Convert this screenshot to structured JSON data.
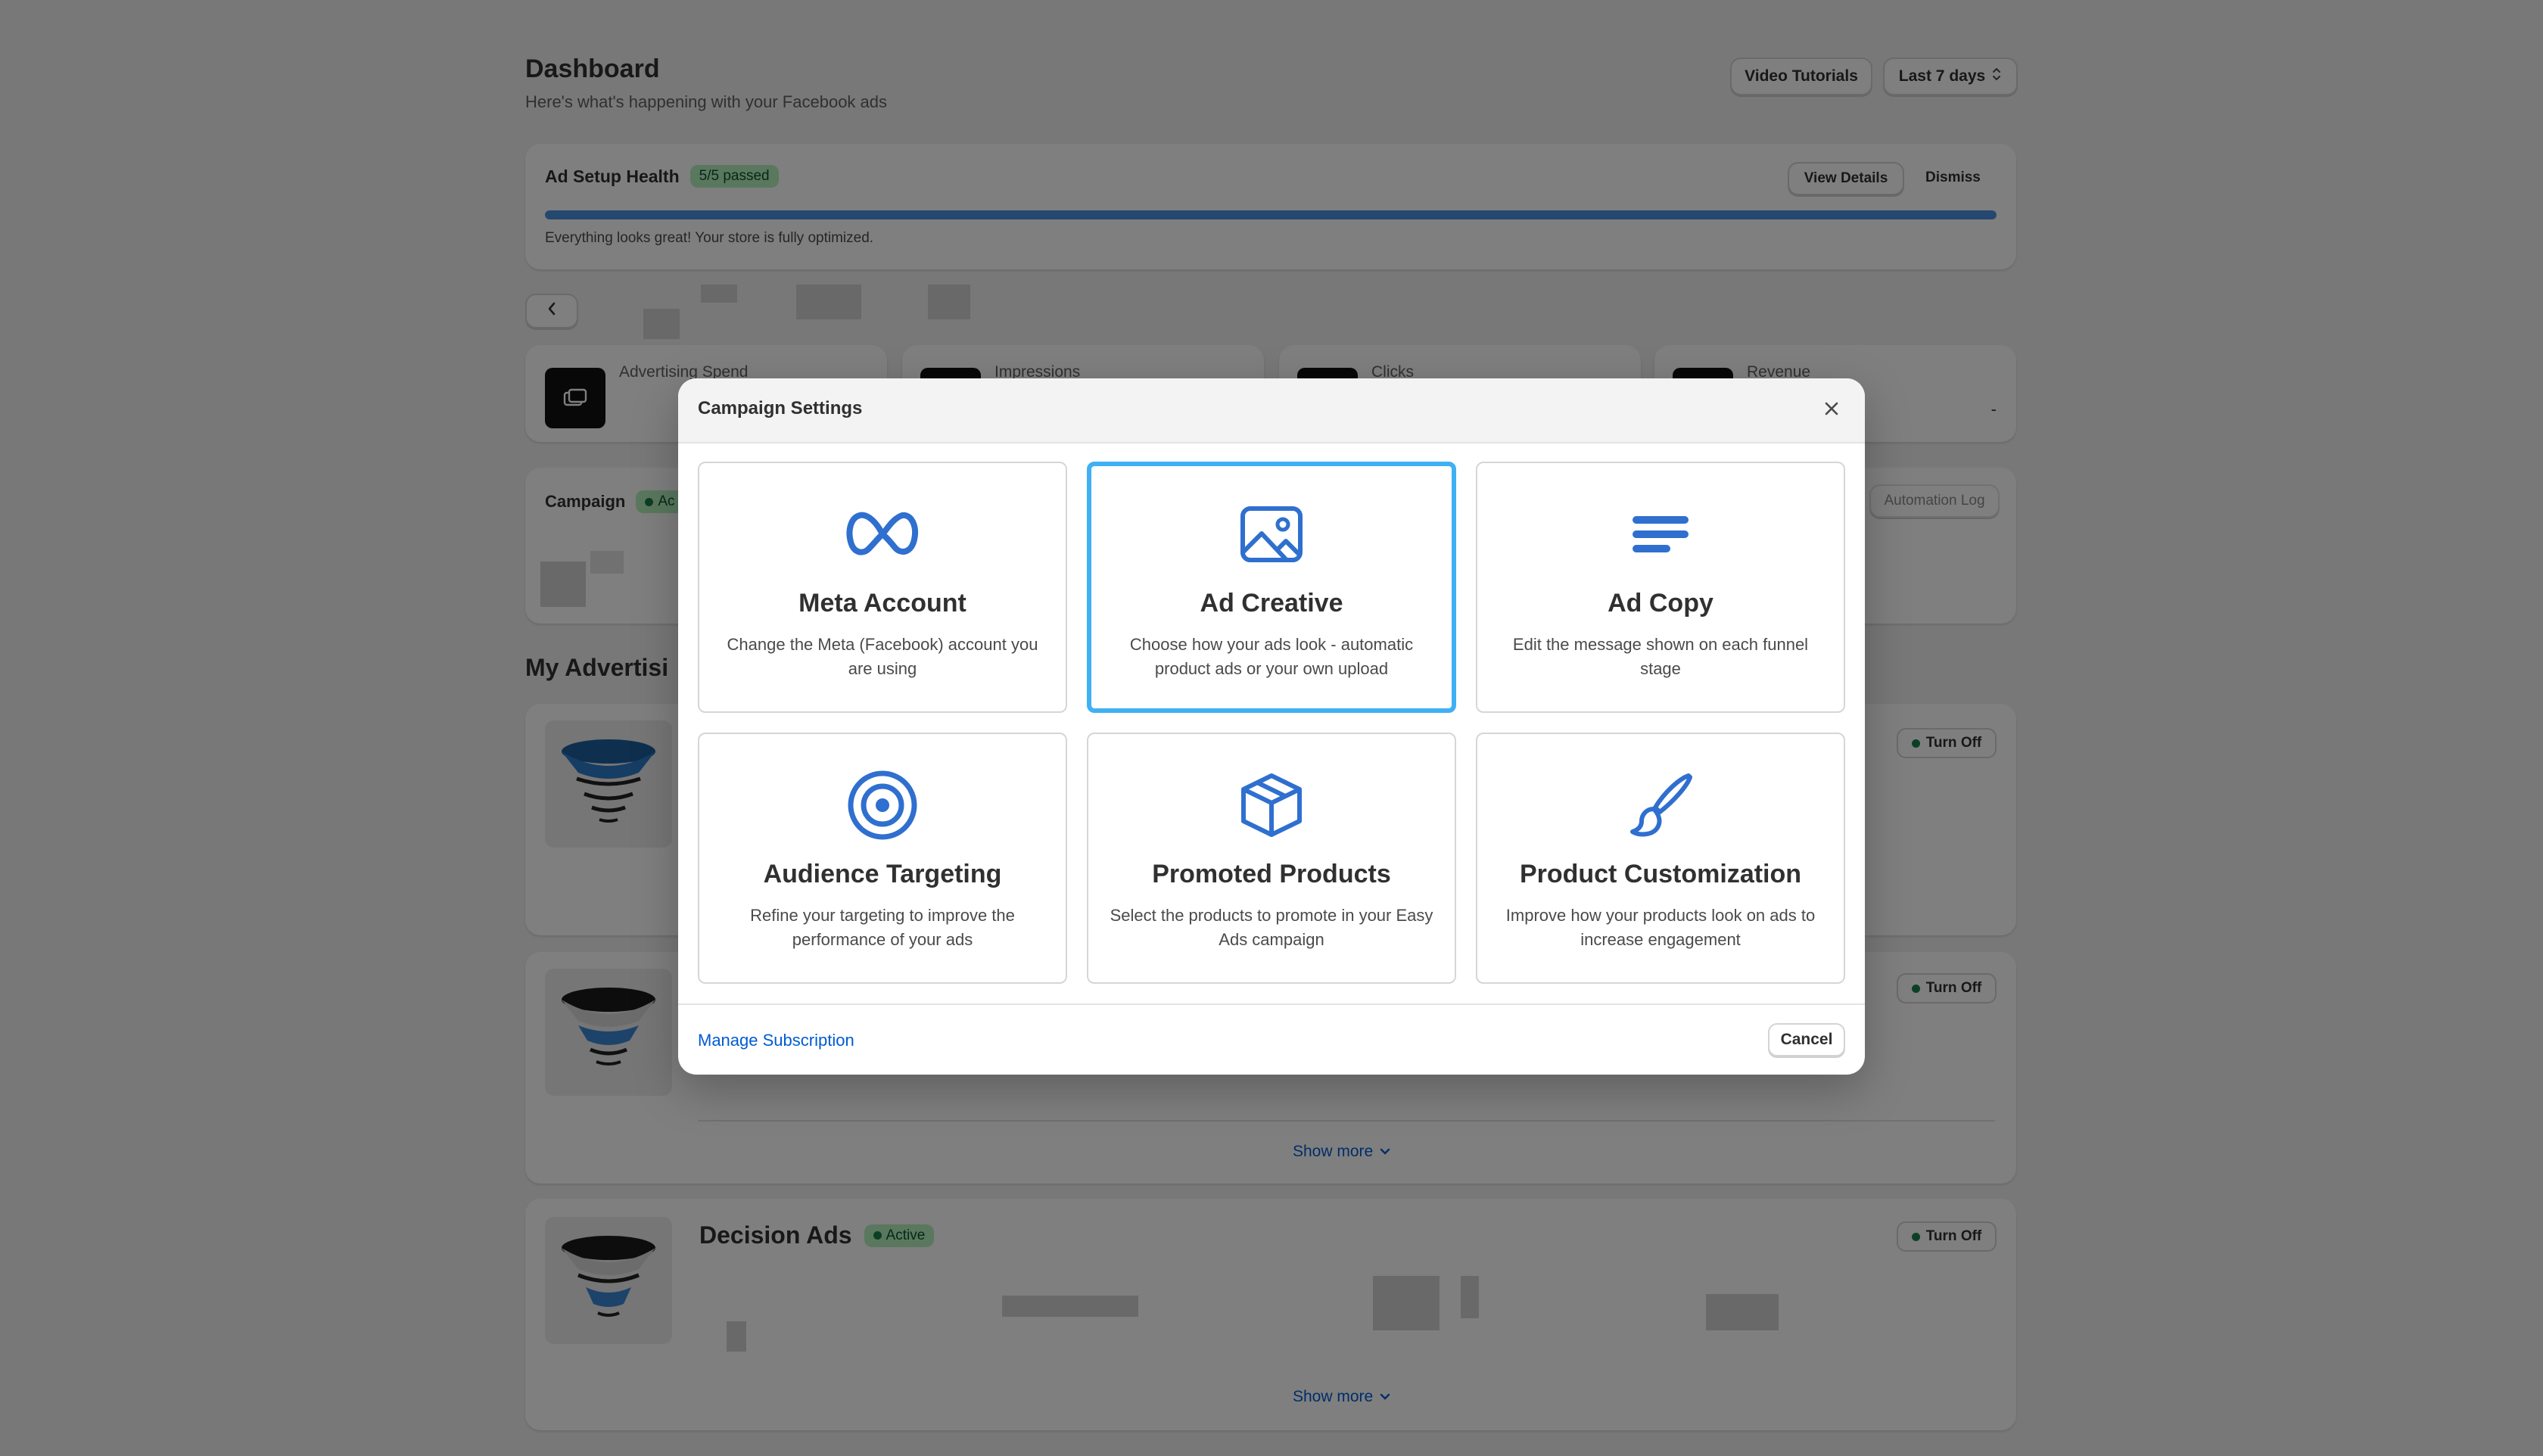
{
  "dashboard": {
    "title": "Dashboard",
    "subtitle": "Here's what's happening with your Facebook ads",
    "video_tutorials_label": "Video Tutorials",
    "date_range_label": "Last 7 days",
    "health": {
      "title": "Ad Setup Health",
      "badge": "5/5 passed",
      "progress_percent": 100,
      "message": "Everything looks great! Your store is fully optimized.",
      "view_details_label": "View Details",
      "dismiss_label": "Dismiss"
    },
    "metrics": [
      {
        "label": "Advertising Spend"
      },
      {
        "label": "Impressions"
      },
      {
        "label": "Clicks"
      },
      {
        "label": "Revenue",
        "value": "-"
      }
    ],
    "campaign": {
      "label": "Campaign",
      "badge": "Ac",
      "automation_log_label": "Automation Log"
    },
    "section_title": "My Advertisi",
    "ads": [
      {
        "turn_off_label": "Turn Off"
      },
      {
        "turn_off_label": "Turn Off",
        "show_more_label": "Show more"
      },
      {
        "title": "Decision Ads",
        "status": "Active",
        "turn_off_label": "Turn Off",
        "show_more_label": "Show more"
      }
    ]
  },
  "modal": {
    "title": "Campaign Settings",
    "options": [
      {
        "title": "Meta Account",
        "description": "Change the Meta (Facebook) account you are using",
        "icon": "meta-logo-icon"
      },
      {
        "title": "Ad Creative",
        "description": "Choose how your ads look - automatic product ads or your own upload",
        "icon": "image-icon",
        "selected": true
      },
      {
        "title": "Ad Copy",
        "description": "Edit the message shown on each funnel stage",
        "icon": "text-lines-icon"
      },
      {
        "title": "Audience Targeting",
        "description": "Refine your targeting to improve the performance of your ads",
        "icon": "target-icon"
      },
      {
        "title": "Promoted Products",
        "description": "Select the products to promote in your Easy Ads campaign",
        "icon": "box-icon"
      },
      {
        "title": "Product Customization",
        "description": "Improve how your products look on ads to increase engagement",
        "icon": "paintbrush-icon"
      }
    ],
    "manage_subscription_label": "Manage Subscription",
    "cancel_label": "Cancel"
  },
  "colors": {
    "icon_blue": "#2f6fcf",
    "selected_border": "#3fb0f4",
    "link_blue": "#005bd3",
    "badge_green_bg": "#b5f0bd"
  }
}
